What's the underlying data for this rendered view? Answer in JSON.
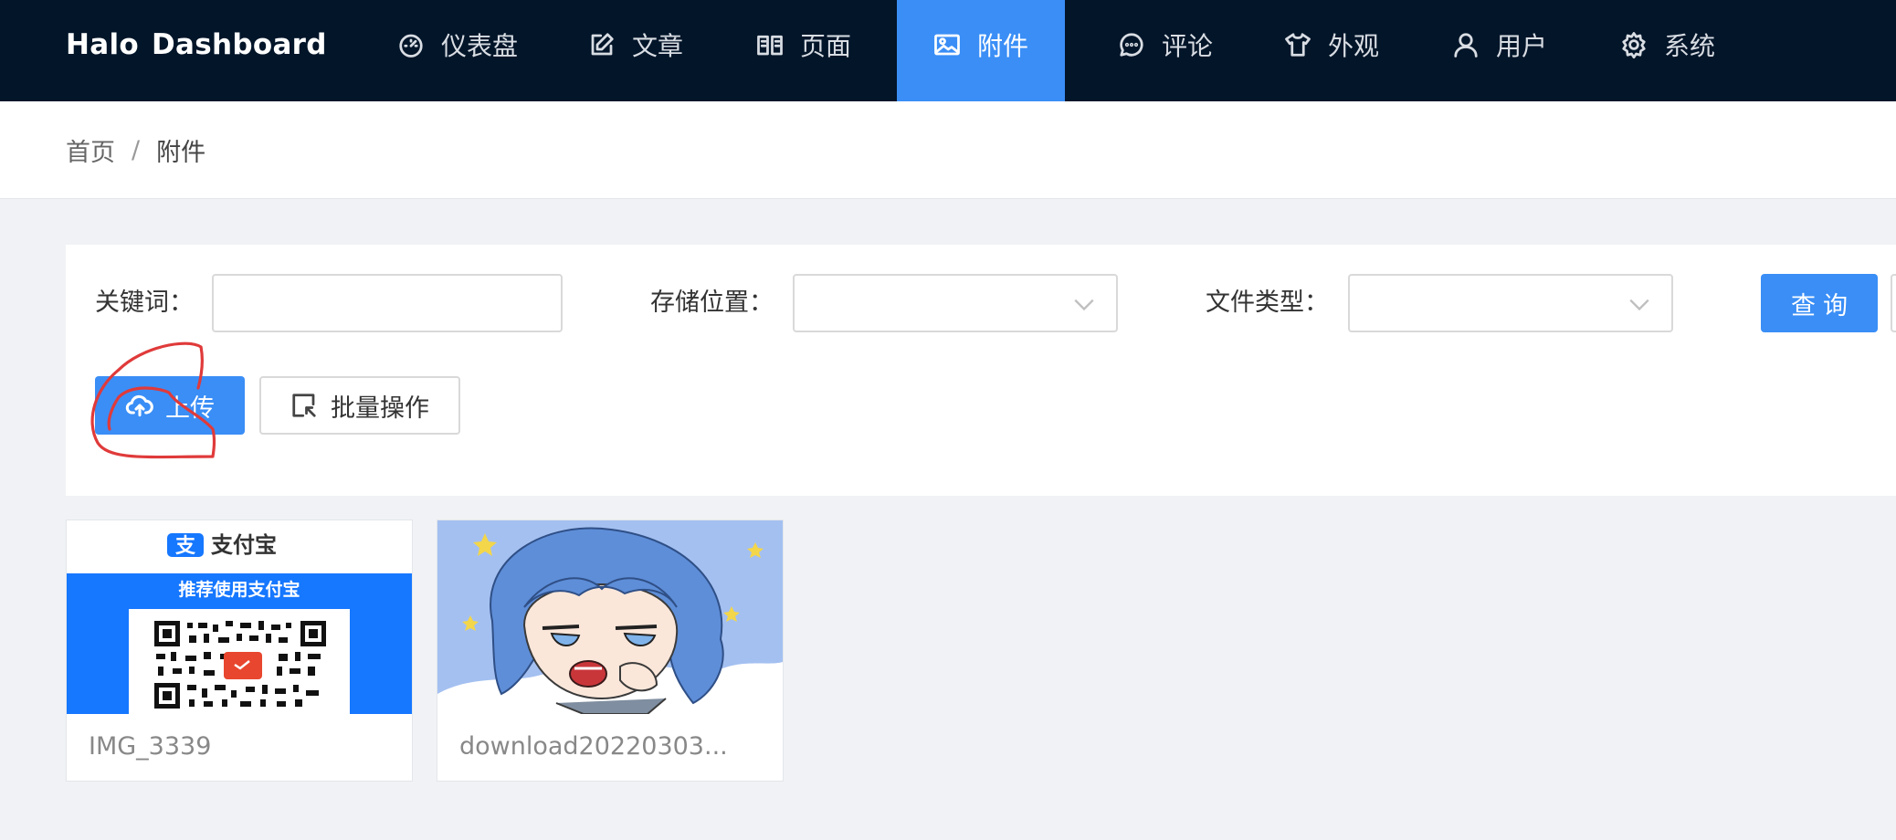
{
  "header": {
    "brand_part1": "Halo",
    "brand_part2": "Dashboard",
    "nav": [
      {
        "label": "仪表盘",
        "icon": "dashboard-icon"
      },
      {
        "label": "文章",
        "icon": "edit-icon"
      },
      {
        "label": "页面",
        "icon": "book-icon"
      },
      {
        "label": "附件",
        "icon": "picture-icon",
        "active": true
      },
      {
        "label": "评论",
        "icon": "comment-icon"
      },
      {
        "label": "外观",
        "icon": "skin-icon"
      },
      {
        "label": "用户",
        "icon": "user-icon"
      },
      {
        "label": "系统",
        "icon": "setting-icon"
      }
    ]
  },
  "breadcrumb": {
    "home": "首页",
    "separator": "/",
    "current": "附件"
  },
  "filters": {
    "keyword_label": "关键词：",
    "keyword_value": "",
    "storage_label": "存储位置：",
    "storage_value": "",
    "type_label": "文件类型：",
    "type_value": "",
    "query_button": "查询"
  },
  "actions": {
    "upload": "上传",
    "batch": "批量操作"
  },
  "attachments": [
    {
      "name": "IMG_3339",
      "thumb_header": "支付宝",
      "thumb_banner": "推荐使用支付宝"
    },
    {
      "name": "download20220303..."
    }
  ],
  "colors": {
    "header_bg": "#021529",
    "primary": "#3a8ef6",
    "page_bg": "#f0f2f5",
    "annotation": "#e03a3a",
    "alipay_blue": "#1677ff"
  }
}
